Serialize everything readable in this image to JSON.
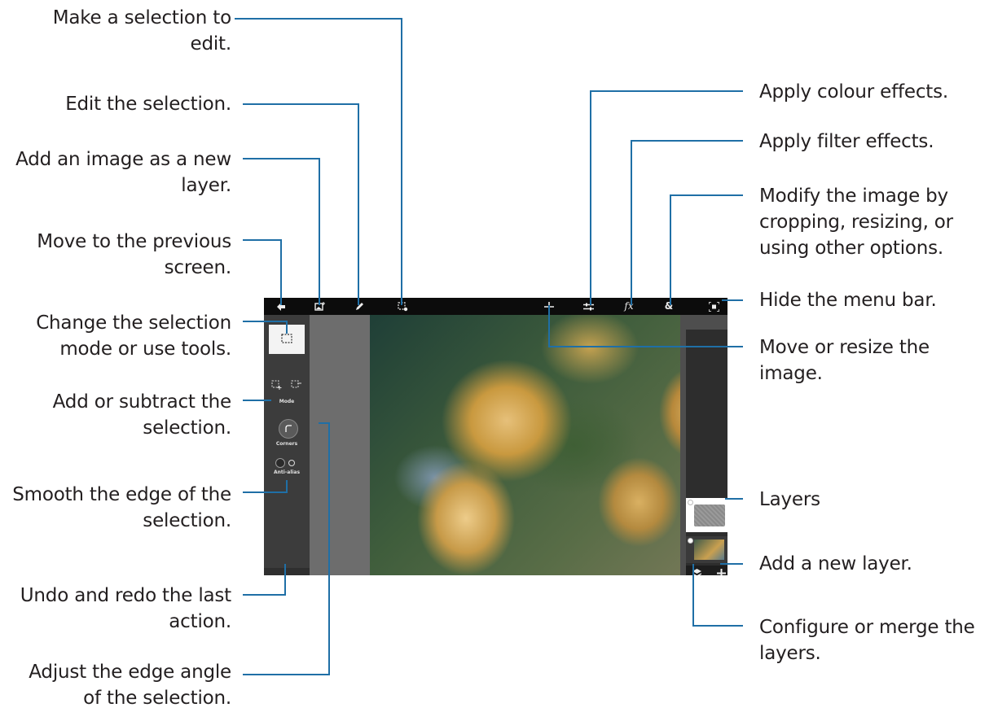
{
  "callouts": {
    "make_selection_1": "Make a selection to",
    "make_selection_2": "edit.",
    "edit_selection": "Edit the selection.",
    "add_image_1": "Add an image as a new",
    "add_image_2": "layer.",
    "move_prev_1": "Move to the previous",
    "move_prev_2": "screen.",
    "change_mode_1": "Change the selection",
    "change_mode_2": "mode or use tools.",
    "add_subtract_1": "Add or subtract the",
    "add_subtract_2": "selection.",
    "smooth_edge_1": "Smooth the edge of the",
    "smooth_edge_2": "selection.",
    "undo_redo_1": "Undo and redo the last",
    "undo_redo_2": "action.",
    "adjust_angle_1": "Adjust the edge angle",
    "adjust_angle_2": "of the selection.",
    "colour_effects": "Apply colour effects.",
    "filter_effects": "Apply filter effects.",
    "modify_image_1": "Modify the image by",
    "modify_image_2": "cropping, resizing, or",
    "modify_image_3": "using other options.",
    "hide_menu": "Hide the menu bar.",
    "move_resize_1": "Move or resize the",
    "move_resize_2": "image.",
    "layers": "Layers",
    "add_layer": "Add a new layer.",
    "configure_1": "Configure or merge the",
    "configure_2": "layers."
  },
  "app": {
    "toolbar": {
      "back_icon": "back-arrow-icon",
      "add_image_icon": "add-image-icon",
      "pencil_icon": "pencil-icon",
      "selection_icon": "selection-settings-icon",
      "move_icon": "move-icon",
      "adjust_icon": "sliders-icon",
      "fx_label": "fx",
      "ampersand_label": "&",
      "fullscreen_icon": "fullscreen-icon"
    },
    "left_panel": {
      "mode_label": "Mode",
      "corners_label": "Corners",
      "antialias_label": "Anti-alias"
    }
  },
  "colors": {
    "callout_line": "#1f6fa6",
    "toolbar_bg": "#0c0c0c",
    "panel_bg": "#3c3c3c"
  }
}
